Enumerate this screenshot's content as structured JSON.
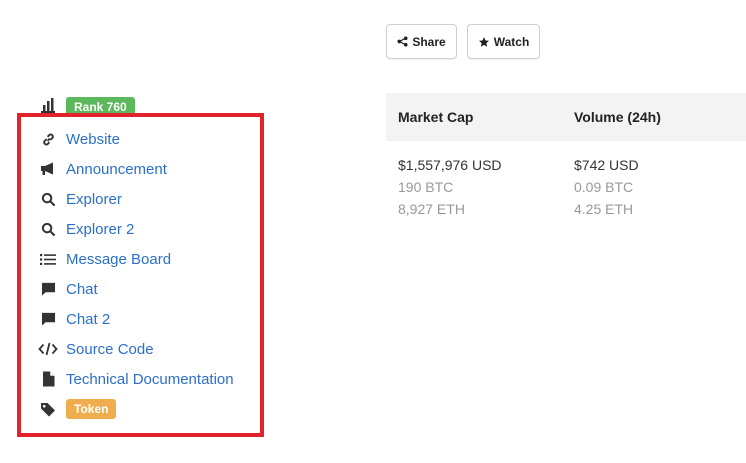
{
  "actions": {
    "share_label": "Share",
    "watch_label": "Watch"
  },
  "rank": {
    "label": "Rank 760",
    "color": "#5cb85c"
  },
  "links": [
    {
      "icon": "link-icon",
      "label": "Website"
    },
    {
      "icon": "megaphone-icon",
      "label": "Announcement"
    },
    {
      "icon": "search-icon",
      "label": "Explorer"
    },
    {
      "icon": "search-icon",
      "label": "Explorer 2"
    },
    {
      "icon": "list-icon",
      "label": "Message Board"
    },
    {
      "icon": "chat-icon",
      "label": "Chat"
    },
    {
      "icon": "chat-icon",
      "label": "Chat 2"
    },
    {
      "icon": "code-icon",
      "label": "Source Code"
    },
    {
      "icon": "document-icon",
      "label": "Technical Documentation"
    }
  ],
  "token": {
    "label": "Token",
    "color": "#f0ad4e"
  },
  "stats": {
    "headers": [
      "Market Cap",
      "Volume (24h)"
    ],
    "market_cap": {
      "usd": "$1,557,976 USD",
      "btc": "190 BTC",
      "eth": "8,927 ETH"
    },
    "volume": {
      "usd": "$742 USD",
      "btc": "0.09 BTC",
      "eth": "4.25 ETH"
    }
  },
  "colors": {
    "link": "#2a6fc9",
    "highlight": "#e3232b"
  }
}
